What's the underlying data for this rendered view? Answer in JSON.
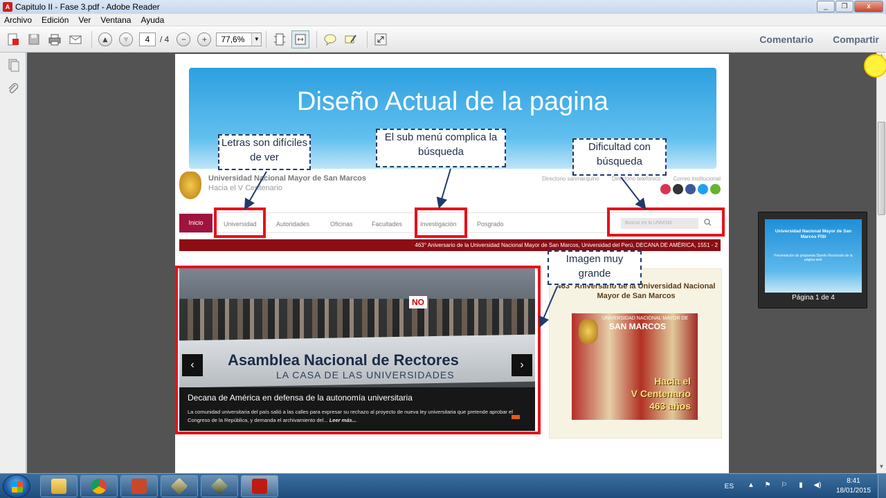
{
  "window": {
    "title": "Capitulo II - Fase 3.pdf - Adobe Reader",
    "controls": [
      "_",
      "❐",
      "x"
    ]
  },
  "menubar": [
    "Archivo",
    "Edición",
    "Ver",
    "Ventana",
    "Ayuda"
  ],
  "toolbar": {
    "page_current": "4",
    "page_total": "/ 4",
    "zoom": "77,6%",
    "comentario": "Comentario",
    "compartir": "Compartir"
  },
  "slide": {
    "title": "Diseño Actual de la pagina",
    "notes": {
      "letras": "Letras son difíciles de ver",
      "submenu": "El sub menú complica la búsqueda",
      "busqueda": "Dificultad con búsqueda",
      "imagen": "Imagen muy grande"
    }
  },
  "site": {
    "name": "Universidad Nacional Mayor de San Marcos",
    "subtitle": "Hacia el V Centenario",
    "top_links": [
      "Directorio sanmarquino",
      "Directorio telefónico",
      "Correo institucional"
    ],
    "nav": [
      "Inicio",
      "Universidad",
      "Autoridades",
      "Oficinas",
      "Facultades",
      "Investigación",
      "Posgrado"
    ],
    "search_placeholder": "Buscar en la UNMSM",
    "ticker": "463° Aniversario de la Universidad Nacional Mayor de San Marcos, Universidad del Perú, DECANA DE AMÉRICA, 1551 - 2",
    "slider": {
      "banner": "Asamblea Nacional de Rectores",
      "banner_sub": "LA CASA DE LAS UNIVERSIDADES",
      "sign": "NO",
      "caption_title": "Decana de América en defensa de la autonomía universitaria",
      "caption_text": "La comunidad universitaria del país salió a las calles para expresar su rechazo al proyecto de nueva ley universitaria que pretende aprobar el Congreso de la República, y demanda el archivamiento del...",
      "read_more": "Leer más..."
    },
    "sidebar": {
      "title": "463° Aniversario de la Universidad Nacional Mayor de San Marcos",
      "img_header": "UNIVERSIDAD NACIONAL MAYOR DE",
      "img_sm": "SAN MARCOS",
      "img_gold1": "Hacia el",
      "img_gold2": "V Centenario",
      "img_gold3": "463 años"
    }
  },
  "thumbnail": {
    "title": "Universidad Nacional Mayor de San Marcos FISI",
    "sub": "Presentación de propuesta Diseño Rectorado de la página web",
    "label": "Página 1 de 4"
  },
  "taskbar": {
    "lang": "ES",
    "time": "8:41",
    "date": "18/01/2015"
  }
}
